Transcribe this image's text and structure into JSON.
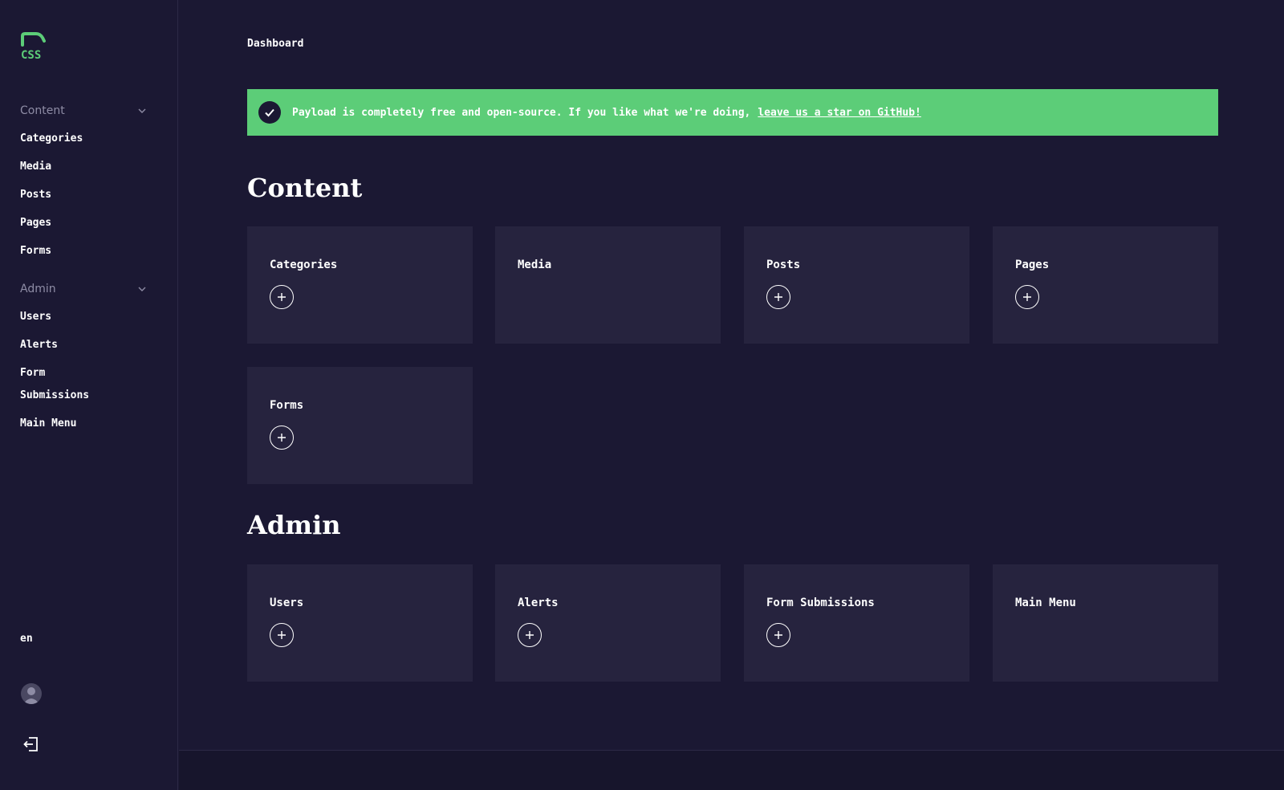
{
  "sidebar": {
    "logo_text": "CSS",
    "groups": [
      {
        "title": "Content",
        "items": [
          "Categories",
          "Media",
          "Posts",
          "Pages",
          "Forms"
        ]
      },
      {
        "title": "Admin",
        "items": [
          "Users",
          "Alerts",
          "Form Submissions",
          "Main Menu"
        ]
      }
    ],
    "language": "en"
  },
  "breadcrumb": "Dashboard",
  "banner": {
    "message": "Payload is completely free and open-source. If you like what we're doing,",
    "link_text": "leave us a star on GitHub!",
    "color": "#5ccd78"
  },
  "sections": [
    {
      "title": "Content",
      "cards": [
        {
          "label": "Categories",
          "has_add": true
        },
        {
          "label": "Media",
          "has_add": false
        },
        {
          "label": "Posts",
          "has_add": true
        },
        {
          "label": "Pages",
          "has_add": true
        },
        {
          "label": "Forms",
          "has_add": true
        }
      ]
    },
    {
      "title": "Admin",
      "cards": [
        {
          "label": "Users",
          "has_add": true
        },
        {
          "label": "Alerts",
          "has_add": true
        },
        {
          "label": "Form Submissions",
          "has_add": true
        },
        {
          "label": "Main Menu",
          "has_add": false
        }
      ]
    }
  ],
  "colors": {
    "background": "#1b1833",
    "card": "#26233e",
    "accent": "#5ccd78"
  },
  "icons": [
    "css-logo-icon",
    "chevron-down-icon",
    "check-icon",
    "plus-icon",
    "avatar-icon",
    "logout-icon"
  ]
}
